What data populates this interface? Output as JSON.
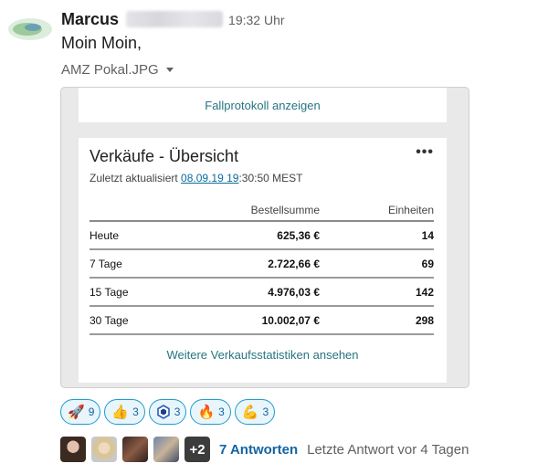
{
  "message": {
    "sender": "Marcus",
    "time": "19:32 Uhr",
    "text": "Moin Moin,",
    "file_name": "AMZ Pokal.JPG"
  },
  "preview": {
    "top_link": "Fallprotokoll anzeigen",
    "card": {
      "title": "Verkäufe - Übersicht",
      "menu": "•••",
      "updated_prefix": "Zuletzt aktualisiert ",
      "updated_date": "08.09.19 19",
      "updated_suffix": ":30:50 MEST",
      "columns": [
        "",
        "Bestellsumme",
        "Einheiten"
      ],
      "rows": [
        {
          "label": "Heute",
          "sum": "625,36 €",
          "units": "14"
        },
        {
          "label": "7 Tage",
          "sum": "2.722,66 €",
          "units": "69"
        },
        {
          "label": "15 Tage",
          "sum": "4.976,03 €",
          "units": "142"
        },
        {
          "label": "30 Tage",
          "sum": "10.002,07 €",
          "units": "298"
        }
      ],
      "more_link": "Weitere Verkaufsstatistiken ansehen"
    }
  },
  "reactions": [
    {
      "icon": "rocket-icon",
      "emoji": "🚀",
      "count": "9"
    },
    {
      "icon": "thumbs-up-icon",
      "emoji": "👍",
      "count": "3"
    },
    {
      "icon": "blue-hexagon-icon",
      "emoji": "",
      "count": "3"
    },
    {
      "icon": "fire-icon",
      "emoji": "🔥",
      "count": "3"
    },
    {
      "icon": "flexed-biceps-icon",
      "emoji": "💪",
      "count": "3"
    }
  ],
  "thread": {
    "more_avatars": "+2",
    "replies": "7 Antworten",
    "last_reply": "Letzte Antwort vor 4 Tagen"
  },
  "colors": {
    "link_blue": "#1264a3",
    "teal_link": "#277582",
    "reaction_border": "#1d9bd1",
    "reaction_bg": "#e8f5fa"
  }
}
